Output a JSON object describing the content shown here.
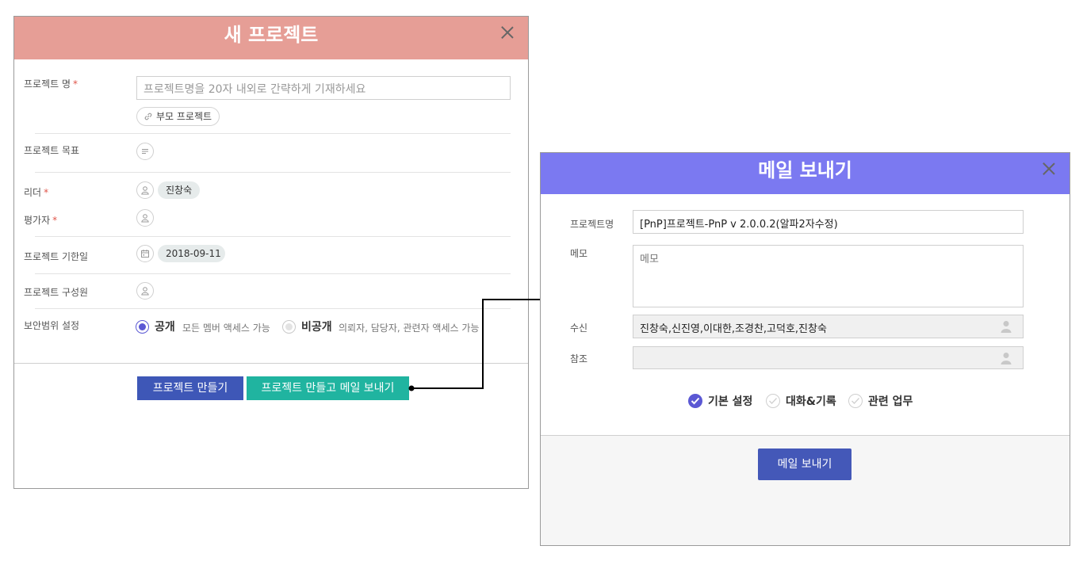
{
  "new_project": {
    "title": "새 프로젝트",
    "name_label": "프로젝트 명",
    "name_placeholder": "프로젝트명을 20자 내외로 간략하게 기재하세요",
    "parent_label": "부모 프로젝트",
    "goal_label": "프로젝트 목표",
    "leader_label": "리더",
    "leader_value": "진창숙",
    "evaluator_label": "평가자",
    "deadline_label": "프로젝트 기한일",
    "deadline_value": "2018-09-11",
    "members_label": "프로젝트 구성원",
    "security_label": "보안범위 설정",
    "required_mark": "*",
    "security_options": [
      {
        "name": "공개",
        "desc": "모든 멤버 액세스 가능",
        "selected": true
      },
      {
        "name": "비공개",
        "desc": "의뢰자, 담당자, 관련자 액세스 가능",
        "selected": false
      }
    ],
    "create_button": "프로젝트 만들기",
    "create_mail_button": "프로젝트 만들고 메일 보내기"
  },
  "send_mail": {
    "title": "메일 보내기",
    "project_label": "프로젝트명",
    "project_value": "[PnP]프로젝트-PnP v 2.0.0.2(알파2자수정)",
    "memo_label": "메모",
    "memo_placeholder": "메모",
    "to_label": "수신",
    "to_value": "진창숙,신진영,이대한,조경찬,고덕호,진창숙",
    "cc_label": "참조",
    "cc_value": "",
    "options": [
      {
        "label": "기본 설정",
        "checked": true
      },
      {
        "label": "대화&기록",
        "checked": false
      },
      {
        "label": "관련 업무",
        "checked": false
      }
    ],
    "send_button": "메일 보내기"
  },
  "colors": {
    "new_project_header": "#e69e96",
    "send_mail_header": "#7b79f1",
    "primary_button": "#3e57b7",
    "teal_button": "#20b4a0",
    "radio_accent": "#5b58d4"
  }
}
